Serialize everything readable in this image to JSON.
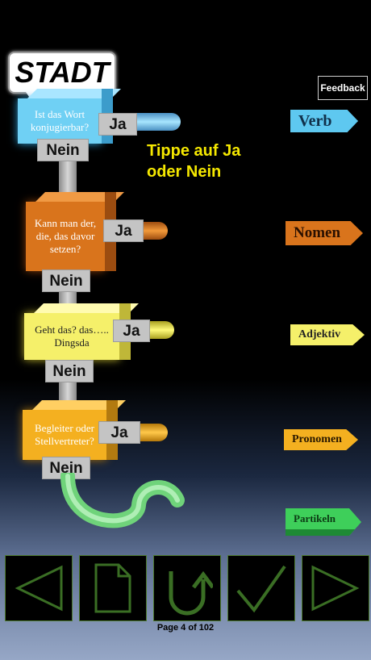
{
  "word": "STADT",
  "feedback_label": "Feedback",
  "instruction": "Tippe auf Ja oder Nein",
  "questions": [
    {
      "text": "Ist das Wort konjugierbar?",
      "yes": "Ja",
      "no": "Nein"
    },
    {
      "text": "Kann man der, die, das davor setzen?",
      "yes": "Ja",
      "no": "Nein"
    },
    {
      "text": "Geht das? das….. Dingsda",
      "yes": "Ja",
      "no": "Nein"
    },
    {
      "text": "Begleiter oder Stellvertreter?",
      "yes": "Ja",
      "no": "Nein"
    }
  ],
  "categories": {
    "verb": "Verb",
    "nomen": "Nomen",
    "adjektiv": "Adjektiv",
    "pronomen": "Pronomen",
    "partikeln": "Partikeln"
  },
  "page_indicator": "Page 4 of 102",
  "colors": {
    "blue": "#5ec8f0",
    "orange": "#d9741c",
    "yellow": "#f5f06a",
    "amber": "#f4b020",
    "green": "#3ecf5a",
    "instruction": "#f5e800"
  },
  "toolbar": {
    "back_icon": "triangle-left-icon",
    "page_icon": "page-icon",
    "undo_icon": "u-turn-arrow-icon",
    "check_icon": "checkmark-icon",
    "forward_icon": "triangle-right-icon"
  }
}
